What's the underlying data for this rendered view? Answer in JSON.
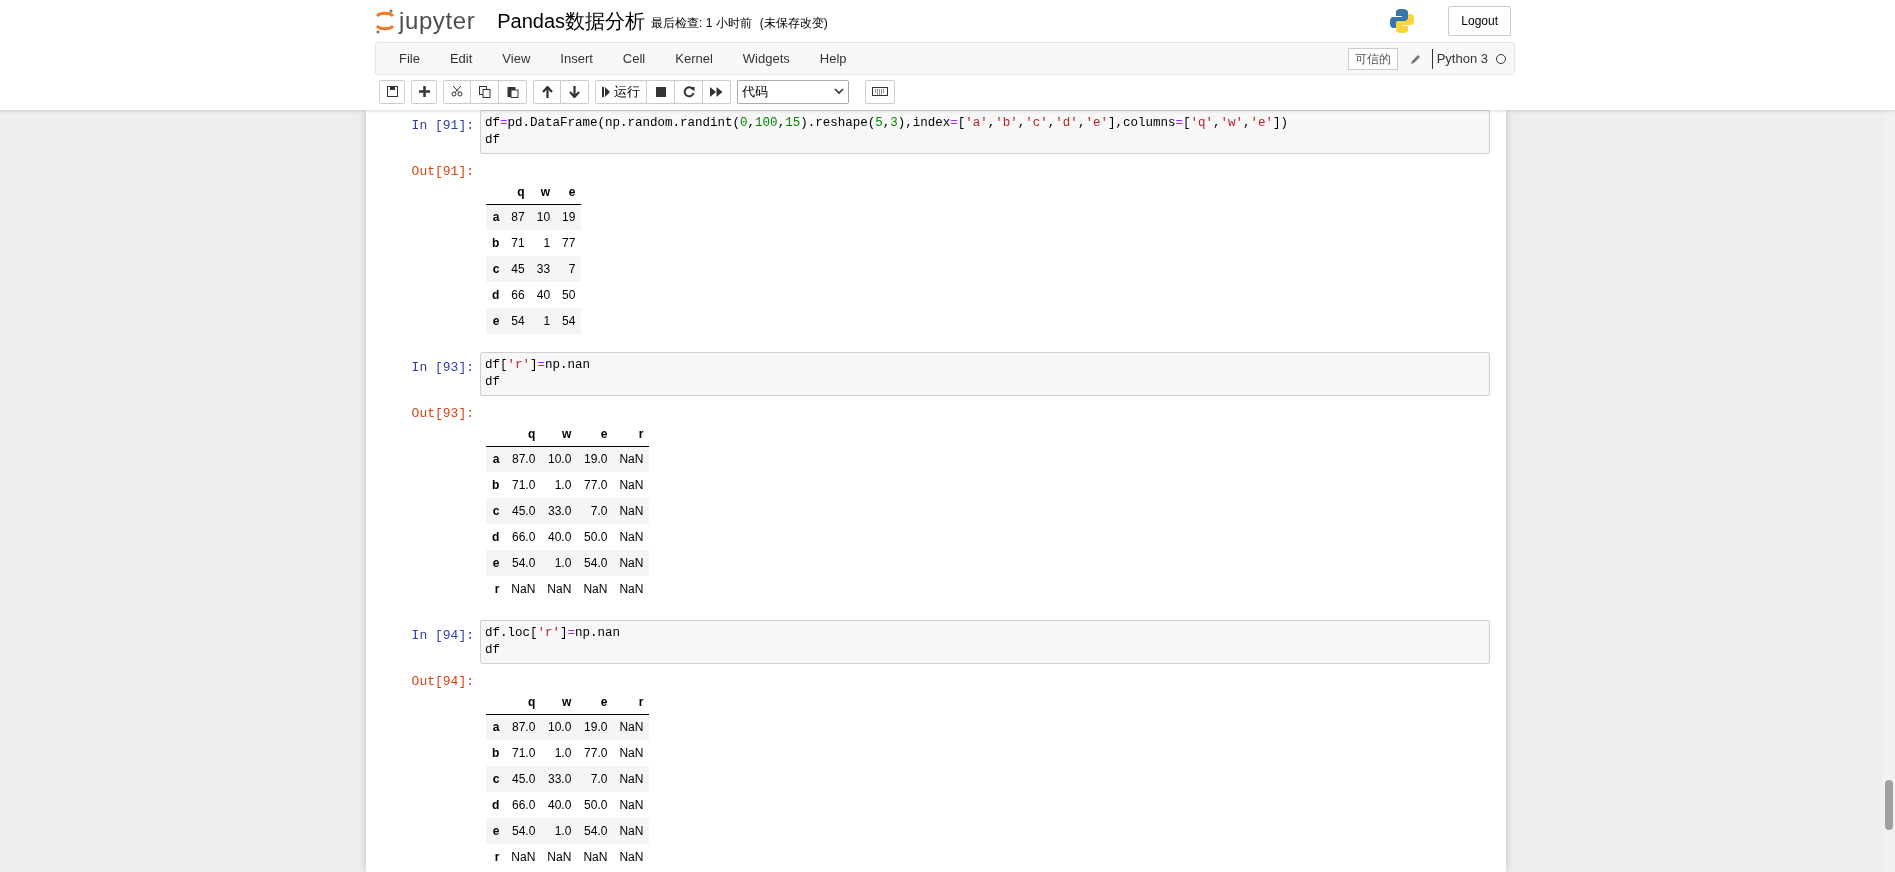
{
  "header": {
    "logo_text": "jupyter",
    "notebook_title": "Pandas数据分析",
    "checkpoint": "最后检查: 1 小时前",
    "autosave_status": "(未保存改变)",
    "logout": "Logout"
  },
  "menu": [
    "File",
    "Edit",
    "View",
    "Insert",
    "Cell",
    "Kernel",
    "Widgets",
    "Help"
  ],
  "kernel": {
    "trusted": "可信的",
    "name": "Python 3",
    "busy": false
  },
  "toolbar": {
    "run_label": "运行",
    "cell_type": "代码"
  },
  "cells": [
    {
      "in_prompt": "In [91]:",
      "code": [
        [
          {
            "text": "df",
            "kind": "name"
          },
          {
            "text": "=",
            "kind": "op"
          },
          {
            "text": "pd.DataFrame(np.random.randint(",
            "kind": "name"
          },
          {
            "text": "0",
            "kind": "num"
          },
          {
            "text": ",",
            "kind": "name"
          },
          {
            "text": "100",
            "kind": "num"
          },
          {
            "text": ",",
            "kind": "name"
          },
          {
            "text": "15",
            "kind": "num"
          },
          {
            "text": ").reshape(",
            "kind": "name"
          },
          {
            "text": "5",
            "kind": "num"
          },
          {
            "text": ",",
            "kind": "name"
          },
          {
            "text": "3",
            "kind": "num"
          },
          {
            "text": "),index",
            "kind": "name"
          },
          {
            "text": "=",
            "kind": "op"
          },
          {
            "text": "[",
            "kind": "name"
          },
          {
            "text": "'a'",
            "kind": "str"
          },
          {
            "text": ",",
            "kind": "name"
          },
          {
            "text": "'b'",
            "kind": "str"
          },
          {
            "text": ",",
            "kind": "name"
          },
          {
            "text": "'c'",
            "kind": "str"
          },
          {
            "text": ",",
            "kind": "name"
          },
          {
            "text": "'d'",
            "kind": "str"
          },
          {
            "text": ",",
            "kind": "name"
          },
          {
            "text": "'e'",
            "kind": "str"
          },
          {
            "text": "],columns",
            "kind": "name"
          },
          {
            "text": "=",
            "kind": "op"
          },
          {
            "text": "[",
            "kind": "name"
          },
          {
            "text": "'q'",
            "kind": "str"
          },
          {
            "text": ",",
            "kind": "name"
          },
          {
            "text": "'w'",
            "kind": "str"
          },
          {
            "text": ",",
            "kind": "name"
          },
          {
            "text": "'e'",
            "kind": "str"
          },
          {
            "text": "])",
            "kind": "name"
          }
        ],
        [
          {
            "text": "df",
            "kind": "name"
          }
        ]
      ],
      "out_prompt": "Out[91]:",
      "table": {
        "columns": [
          "q",
          "w",
          "e"
        ],
        "rows": [
          {
            "index": "a",
            "cells": [
              "87",
              "10",
              "19"
            ]
          },
          {
            "index": "b",
            "cells": [
              "71",
              "1",
              "77"
            ]
          },
          {
            "index": "c",
            "cells": [
              "45",
              "33",
              "7"
            ]
          },
          {
            "index": "d",
            "cells": [
              "66",
              "40",
              "50"
            ]
          },
          {
            "index": "e",
            "cells": [
              "54",
              "1",
              "54"
            ]
          }
        ]
      }
    },
    {
      "in_prompt": "In [93]:",
      "code": [
        [
          {
            "text": "df[",
            "kind": "name"
          },
          {
            "text": "'r'",
            "kind": "str"
          },
          {
            "text": "]",
            "kind": "name"
          },
          {
            "text": "=",
            "kind": "op"
          },
          {
            "text": "np.nan",
            "kind": "name"
          }
        ],
        [
          {
            "text": "df",
            "kind": "name"
          }
        ]
      ],
      "out_prompt": "Out[93]:",
      "table": {
        "columns": [
          "q",
          "w",
          "e",
          "r"
        ],
        "rows": [
          {
            "index": "a",
            "cells": [
              "87.0",
              "10.0",
              "19.0",
              "NaN"
            ]
          },
          {
            "index": "b",
            "cells": [
              "71.0",
              "1.0",
              "77.0",
              "NaN"
            ]
          },
          {
            "index": "c",
            "cells": [
              "45.0",
              "33.0",
              "7.0",
              "NaN"
            ]
          },
          {
            "index": "d",
            "cells": [
              "66.0",
              "40.0",
              "50.0",
              "NaN"
            ]
          },
          {
            "index": "e",
            "cells": [
              "54.0",
              "1.0",
              "54.0",
              "NaN"
            ]
          },
          {
            "index": "r",
            "cells": [
              "NaN",
              "NaN",
              "NaN",
              "NaN"
            ]
          }
        ]
      }
    },
    {
      "in_prompt": "In [94]:",
      "code": [
        [
          {
            "text": "df.loc[",
            "kind": "name"
          },
          {
            "text": "'r'",
            "kind": "str"
          },
          {
            "text": "]",
            "kind": "name"
          },
          {
            "text": "=",
            "kind": "op"
          },
          {
            "text": "np.nan",
            "kind": "name"
          }
        ],
        [
          {
            "text": "df",
            "kind": "name"
          }
        ]
      ],
      "out_prompt": "Out[94]:",
      "table": {
        "columns": [
          "q",
          "w",
          "e",
          "r"
        ],
        "rows": [
          {
            "index": "a",
            "cells": [
              "87.0",
              "10.0",
              "19.0",
              "NaN"
            ]
          },
          {
            "index": "b",
            "cells": [
              "71.0",
              "1.0",
              "77.0",
              "NaN"
            ]
          },
          {
            "index": "c",
            "cells": [
              "45.0",
              "33.0",
              "7.0",
              "NaN"
            ]
          },
          {
            "index": "d",
            "cells": [
              "66.0",
              "40.0",
              "50.0",
              "NaN"
            ]
          },
          {
            "index": "e",
            "cells": [
              "54.0",
              "1.0",
              "54.0",
              "NaN"
            ]
          },
          {
            "index": "r",
            "cells": [
              "NaN",
              "NaN",
              "NaN",
              "NaN"
            ]
          }
        ]
      }
    }
  ]
}
